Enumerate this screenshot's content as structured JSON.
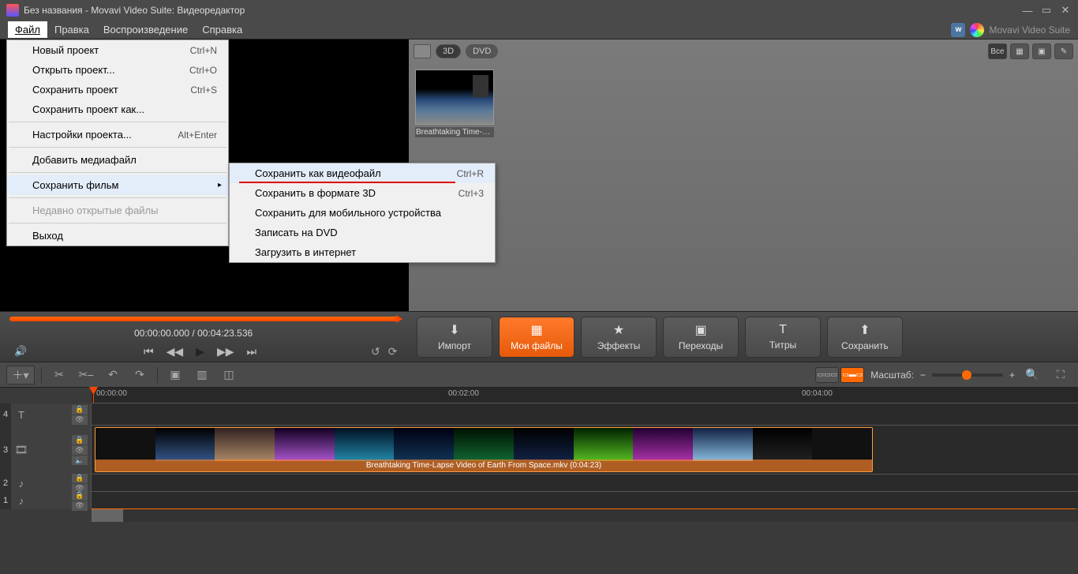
{
  "title": "Без названия - Movavi Video Suite: Видеоредактор",
  "brand": "Movavi Video Suite",
  "menubar": [
    "Файл",
    "Правка",
    "Воспроизведение",
    "Справка"
  ],
  "file_menu": {
    "new_project": {
      "label": "Новый проект",
      "sc": "Ctrl+N"
    },
    "open_project": {
      "label": "Открыть проект...",
      "sc": "Ctrl+O"
    },
    "save_project": {
      "label": "Сохранить проект",
      "sc": "Ctrl+S"
    },
    "save_project_as": {
      "label": "Сохранить проект как..."
    },
    "project_settings": {
      "label": "Настройки проекта...",
      "sc": "Alt+Enter"
    },
    "add_media": {
      "label": "Добавить медиафайл"
    },
    "save_movie": {
      "label": "Сохранить фильм"
    },
    "recent": {
      "label": "Недавно открытые файлы"
    },
    "exit": {
      "label": "Выход"
    }
  },
  "save_submenu": {
    "as_video": {
      "label": "Сохранить как видеофайл",
      "sc": "Ctrl+R"
    },
    "as_3d": {
      "label": "Сохранить в формате 3D",
      "sc": "Ctrl+3"
    },
    "for_mobile": {
      "label": "Сохранить для мобильного устройства"
    },
    "burn_dvd": {
      "label": "Записать на DVD"
    },
    "upload": {
      "label": "Загрузить в интернет"
    }
  },
  "media": {
    "chip_3d": "3D",
    "chip_dvd": "DVD",
    "all": "Все",
    "thumb_label": "Breathtaking Time-Lap..."
  },
  "timecode": {
    "current": "00:00:00.000",
    "sep": " / ",
    "total": "00:04:23.536"
  },
  "bigbtns": {
    "import": "Импорт",
    "myfiles": "Мои файлы",
    "effects": "Эффекты",
    "transitions": "Переходы",
    "titles": "Титры",
    "save": "Сохранить"
  },
  "zoom_label": "Масштаб:",
  "ruler": {
    "t0": "00:00:00",
    "t2": "00:02:00",
    "t4": "00:04:00"
  },
  "clip_label": "Breathtaking Time-Lapse Video of Earth From Space.mkv  (0:04:23)",
  "tracks": {
    "n4": "4",
    "n3": "3",
    "n2": "2",
    "n1": "1"
  }
}
